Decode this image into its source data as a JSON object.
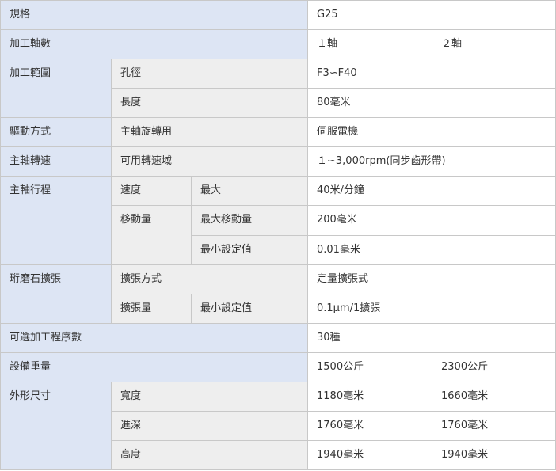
{
  "rows": {
    "model": {
      "label": "規格",
      "value": "G25"
    },
    "axes": {
      "label": "加工軸數",
      "v1": "１軸",
      "v2": "２軸"
    },
    "range": {
      "label": "加工範圍",
      "hole": {
        "label": "孔徑",
        "value": "F3∽F40"
      },
      "length": {
        "label": "長度",
        "value": "80毫米"
      }
    },
    "drive": {
      "label": "驅動方式",
      "sub": "主軸旋轉用",
      "value": "伺服電機"
    },
    "speed": {
      "label": "主軸轉速",
      "sub": "可用轉速域",
      "value": "１∽3,000rpm(同步齒形帶)"
    },
    "stroke": {
      "label": "主軸行程",
      "velocity": {
        "label": "速度",
        "sub": "最大",
        "value": "40米/分鐘"
      },
      "travel": {
        "label": "移動量",
        "max": {
          "label": "最大移動量",
          "value": "200毫米"
        },
        "min_set": {
          "label": "最小設定值",
          "value": "0.01毫米"
        }
      }
    },
    "honing": {
      "label": "珩磨石擴張",
      "method": {
        "label": "擴張方式",
        "value": "定量擴張式"
      },
      "amount": {
        "label": "擴張量",
        "sub": "最小設定值",
        "value": "0.1μm/1擴張"
      }
    },
    "programs": {
      "label": "可選加工程序數",
      "value": "30種"
    },
    "weight": {
      "label": "設備重量",
      "v1": "1500公斤",
      "v2": "2300公斤"
    },
    "dims": {
      "label": "外形尺寸",
      "width": {
        "label": "寬度",
        "v1": "1180毫米",
        "v2": "1660毫米"
      },
      "depth": {
        "label": "進深",
        "v1": "1760毫米",
        "v2": "1760毫米"
      },
      "height": {
        "label": "高度",
        "v1": "1940毫米",
        "v2": "1940毫米"
      }
    }
  }
}
